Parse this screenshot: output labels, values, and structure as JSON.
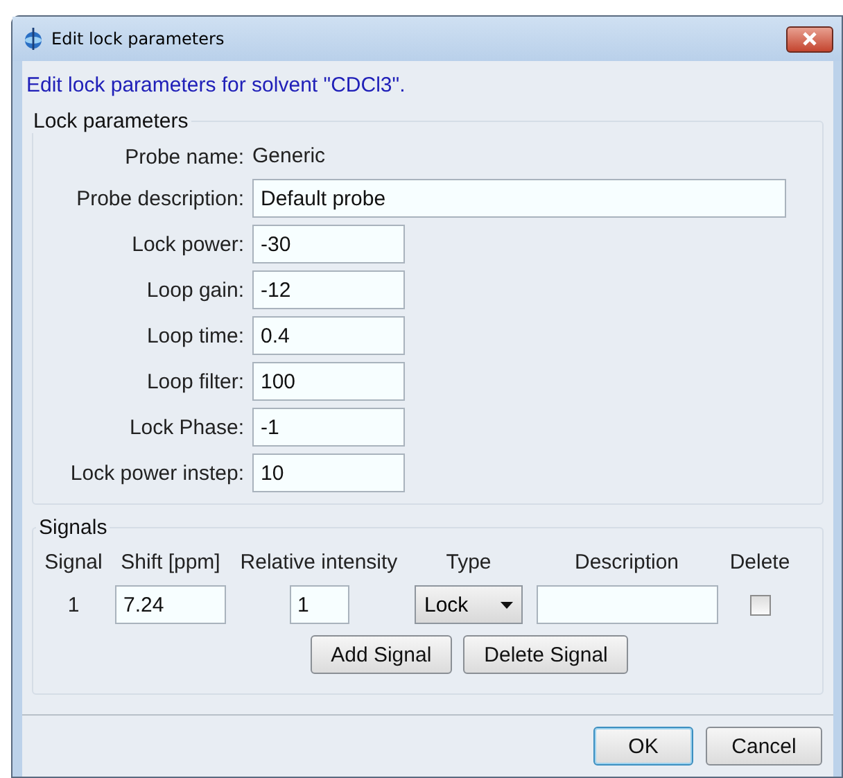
{
  "window": {
    "title": "Edit lock parameters"
  },
  "heading": "Edit lock parameters for solvent \"CDCl3\".",
  "lock_parameters": {
    "title": "Lock parameters",
    "probe_name": {
      "label": "Probe name:",
      "value": "Generic"
    },
    "fields": [
      {
        "label": "Probe description:",
        "value": "Default probe",
        "kind": "wide"
      },
      {
        "label": "Lock power:",
        "value": "-30",
        "kind": "short"
      },
      {
        "label": "Loop gain:",
        "value": "-12",
        "kind": "short"
      },
      {
        "label": "Loop time:",
        "value": "0.4",
        "kind": "short"
      },
      {
        "label": "Loop filter:",
        "value": "100",
        "kind": "short"
      },
      {
        "label": "Lock Phase:",
        "value": "-1",
        "kind": "short"
      },
      {
        "label": "Lock power instep:",
        "value": "10",
        "kind": "short"
      }
    ]
  },
  "signals": {
    "title": "Signals",
    "columns": [
      "Signal",
      "Shift [ppm]",
      "Relative intensity",
      "Type",
      "Description",
      "Delete"
    ],
    "rows": [
      {
        "signal": "1",
        "shift": "7.24",
        "intensity": "1",
        "type": "Lock",
        "checked": false
      }
    ],
    "buttons": [
      "Add Signal",
      "Delete Signal"
    ]
  },
  "buttons": [
    {
      "label": "OK",
      "selected": true
    },
    {
      "label": "Cancel",
      "selected": false
    }
  ]
}
